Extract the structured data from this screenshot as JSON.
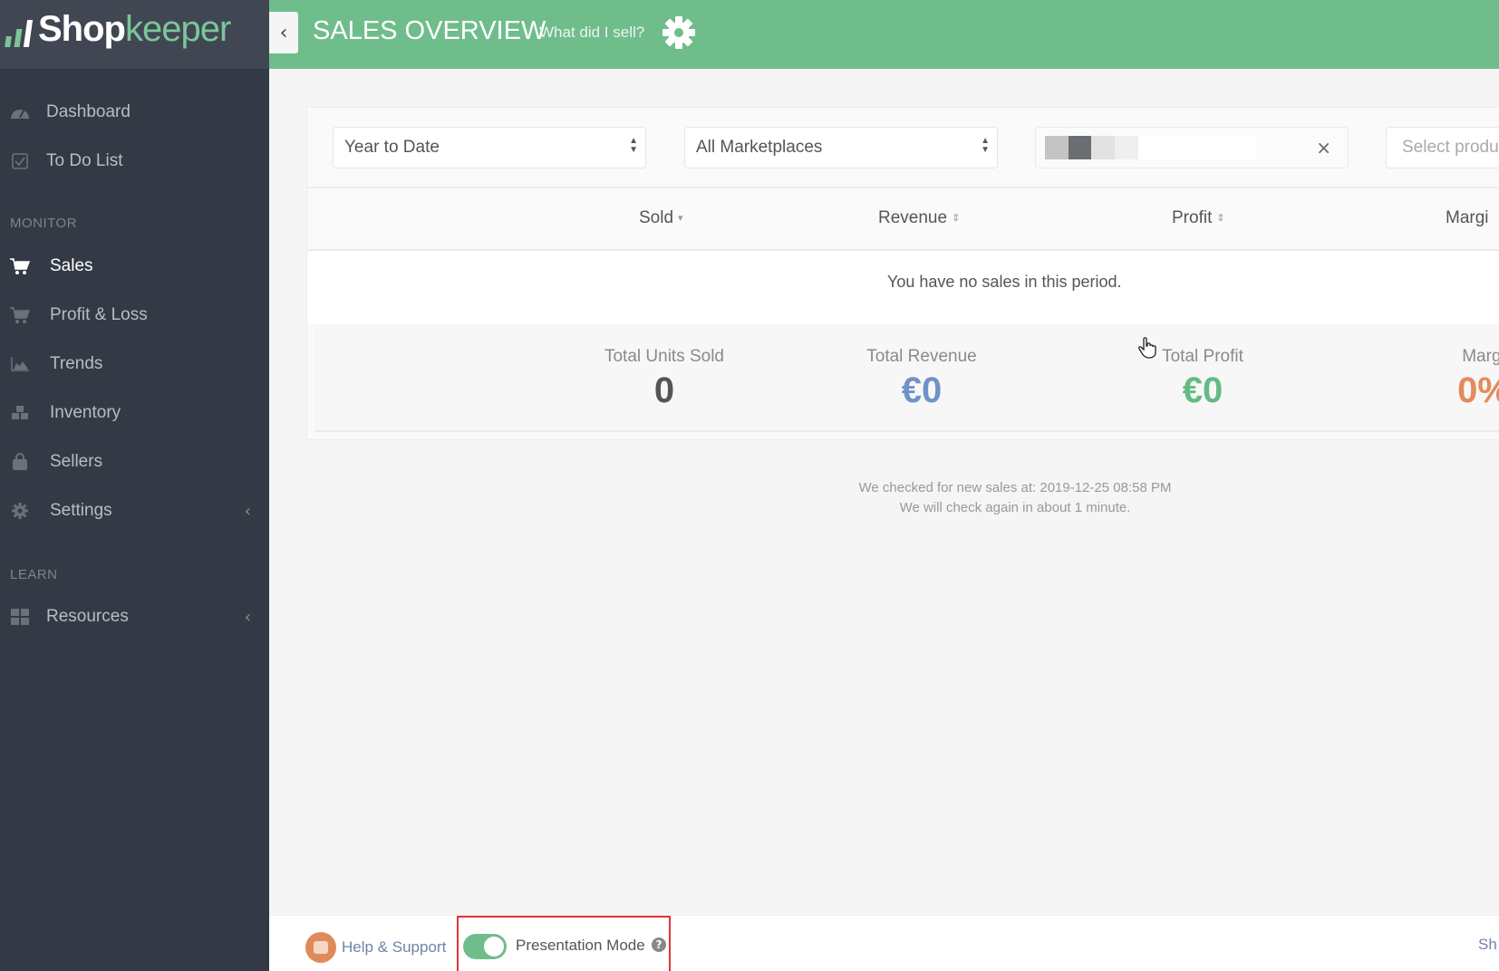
{
  "app": {
    "logo_part1": "Shop",
    "logo_part2": "keeper"
  },
  "sidebar": {
    "top_items": [
      {
        "label": "Dashboard",
        "icon": "dashboard-icon"
      },
      {
        "label": "To Do List",
        "icon": "checkbox-icon"
      }
    ],
    "sections": [
      {
        "title": "MONITOR",
        "items": [
          {
            "label": "Sales",
            "icon": "cart-icon",
            "active": true
          },
          {
            "label": "Profit & Loss",
            "icon": "cart-icon"
          },
          {
            "label": "Trends",
            "icon": "area-chart-icon"
          },
          {
            "label": "Inventory",
            "icon": "cubes-icon"
          },
          {
            "label": "Sellers",
            "icon": "shopping-bag-icon"
          },
          {
            "label": "Settings",
            "icon": "gear-icon",
            "expandable": true
          }
        ]
      },
      {
        "title": "LEARN",
        "items": [
          {
            "label": "Resources",
            "icon": "grid-icon",
            "expandable": true
          }
        ]
      }
    ],
    "chevron": "‹"
  },
  "header": {
    "title": "SALES OVERVIEW",
    "subtitle": "What did I sell?",
    "back": "‹"
  },
  "filters": {
    "period": {
      "value": "Year to Date"
    },
    "marketplace": {
      "value": "All Marketplaces"
    },
    "redacted_field": {
      "clear": "×"
    },
    "product": {
      "placeholder": "Select produ"
    }
  },
  "table": {
    "columns": [
      {
        "label": "Sold",
        "sort": "▾"
      },
      {
        "label": "Revenue",
        "sort": "⇕"
      },
      {
        "label": "Profit",
        "sort": "⇕"
      },
      {
        "label": "Margi"
      }
    ],
    "empty_message": "You have no sales in this period."
  },
  "totals": [
    {
      "label": "Total Units Sold",
      "value": "0",
      "color": "#555555"
    },
    {
      "label": "Total Revenue",
      "value": "€0",
      "color": "#6f93c8"
    },
    {
      "label": "Total Profit",
      "value": "€0",
      "color": "#63bb83"
    },
    {
      "label": "Margi",
      "value": "0%",
      "color": "#e58a5a"
    }
  ],
  "status": {
    "line1": "We checked for new sales at: 2019-12-25 08:58 PM",
    "line2": "We will check again in about 1 minute."
  },
  "footer": {
    "help_label": "Help & Support",
    "presentation_mode_label": "Presentation Mode",
    "presentation_mode_on": true,
    "help_qmark": "?",
    "right_text": "Sh"
  },
  "colors": {
    "brand_green": "#6fbd8b",
    "sidebar_bg": "#343a45",
    "highlight_box": "#e4333b"
  }
}
